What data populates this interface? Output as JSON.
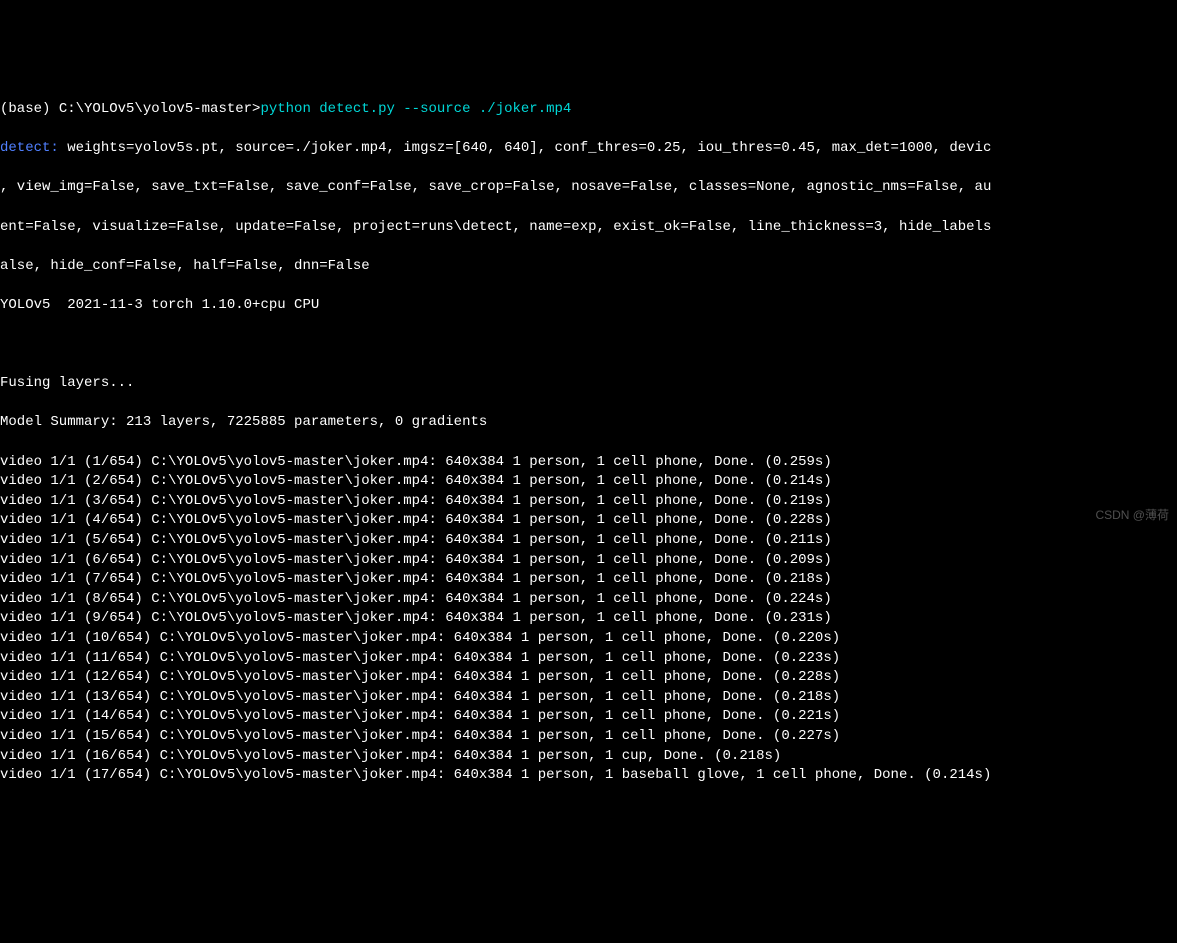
{
  "prompt": {
    "env": "(base) ",
    "path": "C:\\YOLOv5\\yolov5-master>",
    "command": "python detect.py --source ./joker.mp4"
  },
  "detect_label": "detect:",
  "config_line1": " weights=yolov5s.pt, source=./joker.mp4, imgsz=[640, 640], conf_thres=0.25, iou_thres=0.45, max_det=1000, devic",
  "config_line2": ", view_img=False, save_txt=False, save_conf=False, save_crop=False, nosave=False, classes=None, agnostic_nms=False, au",
  "config_line3": "ent=False, visualize=False, update=False, project=runs\\detect, name=exp, exist_ok=False, line_thickness=3, hide_labels",
  "config_line4": "alse, hide_conf=False, half=False, dnn=False",
  "yolo_header": "YOLOv5  2021-11-3 torch 1.10.0+cpu CPU",
  "fusing": "Fusing layers...",
  "model_summary": "Model Summary: 213 layers, 7225885 parameters, 0 gradients",
  "frames": [
    "video 1/1 (1/654) C:\\YOLOv5\\yolov5-master\\joker.mp4: 640x384 1 person, 1 cell phone, Done. (0.259s)",
    "video 1/1 (2/654) C:\\YOLOv5\\yolov5-master\\joker.mp4: 640x384 1 person, 1 cell phone, Done. (0.214s)",
    "video 1/1 (3/654) C:\\YOLOv5\\yolov5-master\\joker.mp4: 640x384 1 person, 1 cell phone, Done. (0.219s)",
    "video 1/1 (4/654) C:\\YOLOv5\\yolov5-master\\joker.mp4: 640x384 1 person, 1 cell phone, Done. (0.228s)",
    "video 1/1 (5/654) C:\\YOLOv5\\yolov5-master\\joker.mp4: 640x384 1 person, 1 cell phone, Done. (0.211s)",
    "video 1/1 (6/654) C:\\YOLOv5\\yolov5-master\\joker.mp4: 640x384 1 person, 1 cell phone, Done. (0.209s)",
    "video 1/1 (7/654) C:\\YOLOv5\\yolov5-master\\joker.mp4: 640x384 1 person, 1 cell phone, Done. (0.218s)",
    "video 1/1 (8/654) C:\\YOLOv5\\yolov5-master\\joker.mp4: 640x384 1 person, 1 cell phone, Done. (0.224s)",
    "video 1/1 (9/654) C:\\YOLOv5\\yolov5-master\\joker.mp4: 640x384 1 person, 1 cell phone, Done. (0.231s)",
    "video 1/1 (10/654) C:\\YOLOv5\\yolov5-master\\joker.mp4: 640x384 1 person, 1 cell phone, Done. (0.220s)",
    "video 1/1 (11/654) C:\\YOLOv5\\yolov5-master\\joker.mp4: 640x384 1 person, 1 cell phone, Done. (0.223s)",
    "video 1/1 (12/654) C:\\YOLOv5\\yolov5-master\\joker.mp4: 640x384 1 person, 1 cell phone, Done. (0.228s)",
    "video 1/1 (13/654) C:\\YOLOv5\\yolov5-master\\joker.mp4: 640x384 1 person, 1 cell phone, Done. (0.218s)",
    "video 1/1 (14/654) C:\\YOLOv5\\yolov5-master\\joker.mp4: 640x384 1 person, 1 cell phone, Done. (0.221s)",
    "video 1/1 (15/654) C:\\YOLOv5\\yolov5-master\\joker.mp4: 640x384 1 person, 1 cell phone, Done. (0.227s)",
    "video 1/1 (16/654) C:\\YOLOv5\\yolov5-master\\joker.mp4: 640x384 1 person, 1 cup, Done. (0.218s)",
    "video 1/1 (17/654) C:\\YOLOv5\\yolov5-master\\joker.mp4: 640x384 1 person, 1 baseball glove, 1 cell phone, Done. (0.214s)"
  ],
  "watermark": "CSDN @薄荷"
}
